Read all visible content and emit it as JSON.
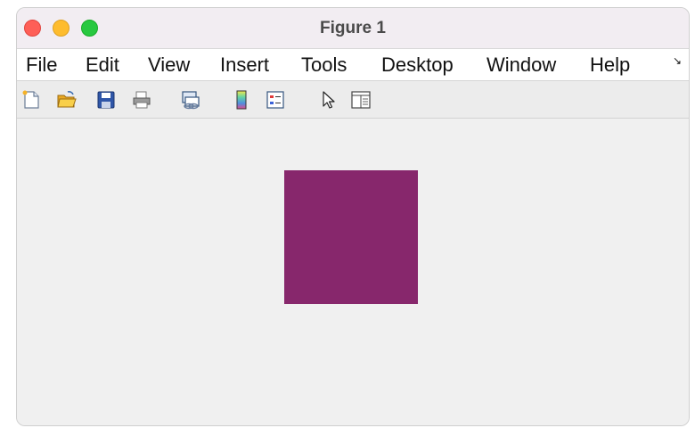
{
  "window": {
    "title": "Figure 1"
  },
  "menu": {
    "items": [
      "File",
      "Edit",
      "View",
      "Insert",
      "Tools",
      "Desktop",
      "Window",
      "Help"
    ]
  },
  "toolbar": {
    "icons": [
      "new-figure-icon",
      "open-file-icon",
      "save-icon",
      "print-icon",
      "link-plot-icon",
      "insert-colorbar-icon",
      "insert-legend-icon",
      "edit-plot-arrow-icon",
      "property-inspector-icon"
    ]
  },
  "figure": {
    "patch_color": "#87276c",
    "background_color": "#f0f0f0"
  }
}
